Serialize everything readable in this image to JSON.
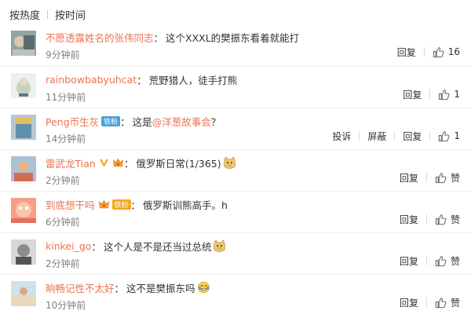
{
  "sort": {
    "hot_label": "按热度",
    "time_label": "按时间"
  },
  "comments": [
    {
      "user": "不愿透露姓名的张伟同志",
      "text": "这个XXXL的樊振东看着就能打",
      "time": "9分钟前",
      "reply": "回复",
      "likes": "16"
    },
    {
      "user": "rainbowbabyuhcat",
      "text": "荒野猎人，徒手打熊",
      "time": "11分钟前",
      "reply": "回复",
      "likes": "1"
    },
    {
      "user": "Peng币生灰",
      "badge": "铁粉",
      "text_before": "这是",
      "mention": "@洋葱故事会",
      "text_after": "？",
      "time": "14分钟前",
      "report": "投诉",
      "block": "屏蔽",
      "reply": "回复",
      "likes": "1"
    },
    {
      "user": "雷武龙Tian",
      "text": "俄罗斯日常(1/365)",
      "time": "2分钟前",
      "reply": "回复",
      "likes": "赞"
    },
    {
      "user": "到底想干吗",
      "badge": "铁粉",
      "text": "俄罗斯训熊高手。h",
      "time": "6分钟前",
      "reply": "回复",
      "likes": "赞"
    },
    {
      "user": "kinkei_go",
      "text": "这个人是不是还当过总统",
      "time": "2分钟前",
      "reply": "回复",
      "likes": "赞"
    },
    {
      "user": "晌畅记性不太好",
      "text": "这不是樊振东吗",
      "time": "10分钟前",
      "reply": "回复",
      "likes": "赞"
    }
  ],
  "colors": {
    "username": "#eb7350",
    "badge": "#f5a623",
    "time": "#808080"
  }
}
